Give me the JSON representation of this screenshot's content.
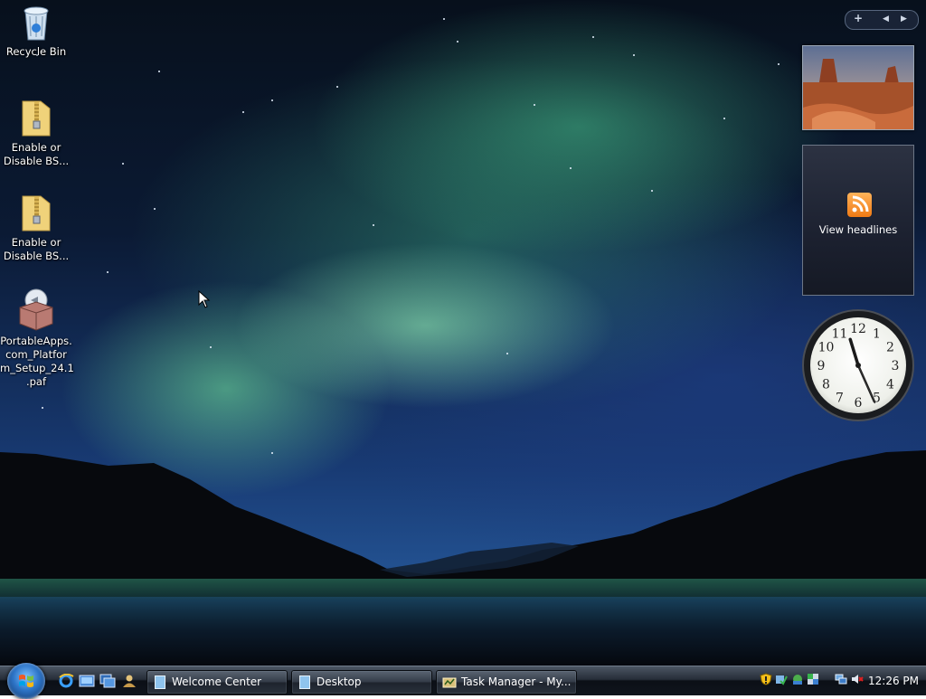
{
  "desktop": {
    "icons": [
      {
        "label": "Recycle Bin",
        "icon": "recycle-bin-icon"
      },
      {
        "label": "Enable or\nDisable BS...",
        "icon": "zip-folder-icon"
      },
      {
        "label": "Enable or\nDisable BS...",
        "icon": "zip-folder-icon"
      },
      {
        "label": "PortableApps.\ncom_Platfor\nm_Setup_24.1\n.paf",
        "icon": "package-installer-icon"
      }
    ]
  },
  "sidebar": {
    "controls": {
      "add": "+",
      "prev": "◀",
      "next": "▶"
    },
    "slideshow": {
      "icon": "desert-photo"
    },
    "feeds": {
      "label": "View headlines",
      "icon": "rss-feed-icon"
    },
    "clock": {
      "hour": 11,
      "minute": 26,
      "second": 26,
      "numerals": [
        "12",
        "1",
        "2",
        "3",
        "4",
        "5",
        "6",
        "7",
        "8",
        "9",
        "10",
        "11"
      ]
    }
  },
  "taskbar": {
    "start": {
      "icon": "windows-logo-icon"
    },
    "quick_launch": [
      {
        "icon": "internet-explorer-icon"
      },
      {
        "icon": "show-desktop-icon"
      },
      {
        "icon": "switch-windows-icon"
      },
      {
        "icon": "user-pane-icon"
      }
    ],
    "tasks": [
      {
        "label": "Welcome Center",
        "icon": "window-icon"
      },
      {
        "label": "Desktop",
        "icon": "window-icon"
      },
      {
        "label": "Task Manager - My...",
        "icon": "task-manager-icon"
      }
    ],
    "tray_icons": [
      "security-shield-icon",
      "updates-icon",
      "network-icon",
      "bluetooth-icon",
      "network-status-icon",
      "volume-muted-icon"
    ],
    "time": "12:26 PM"
  },
  "colors": {
    "taskbar": "#1b2230",
    "aurora": "#6fe0a0",
    "sky": "#0b1a34"
  }
}
